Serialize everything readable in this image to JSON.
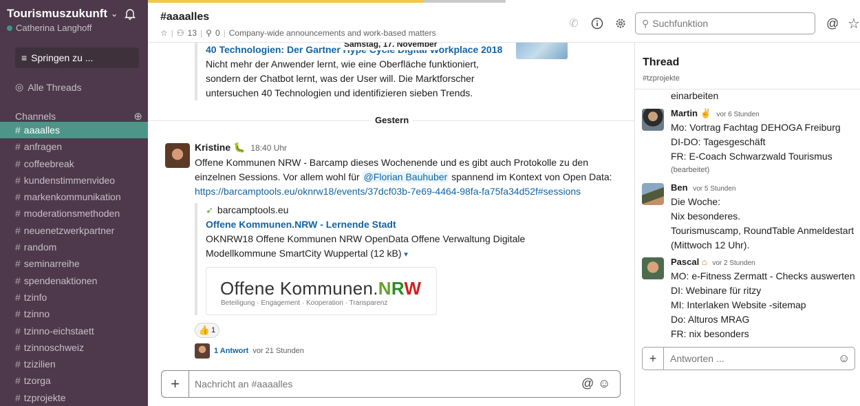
{
  "workspace": {
    "name": "Tourismuszukunft",
    "user": "Catherina Langhoff"
  },
  "sidebar": {
    "jump_label": "Springen zu ...",
    "threads_label": "Alle Threads",
    "channels_heading": "Channels",
    "channels": [
      "aaaalles",
      "anfragen",
      "coffeebreak",
      "kundenstimmenvideo",
      "markenkommunikation",
      "moderationsmethoden",
      "neuenetzwerkpartner",
      "random",
      "seminarreihe",
      "spendenaktionen",
      "tzinfo",
      "tzinno",
      "tzinno-eichstaett",
      "tzinnoschweiz",
      "tzizilien",
      "tzorga",
      "tzprojekte"
    ],
    "active_channel": "aaaalles"
  },
  "header": {
    "channel_title": "#aaaalles",
    "members": "13",
    "pins": "0",
    "description": "Company-wide announcements and work-based matters",
    "search_placeholder": "Suchfunktion"
  },
  "messages": {
    "date_pill": "Samstag, 17. November",
    "prev_attachment": {
      "title": "40 Technologien: Der Gartner Hype Cycle Digital Workplace 2018",
      "lines": [
        "Nicht mehr der Anwender lernt, wie eine Oberfläche funktioniert,",
        "sondern der Chatbot lernt, was der User will. Die Marktforscher",
        "untersuchen 40 Technologien und identifizieren sieben Trends."
      ]
    },
    "divider_label": "Gestern",
    "main": {
      "author": "Kristine",
      "time": "18:40 Uhr",
      "text_1": "Offene Kommunen NRW - Barcamp dieses Wochenende und es gibt auch Protokolle zu den",
      "text_2a": "einzelnen Sessions. Vor allem wohl für",
      "mention": "@Florian Bauhuber",
      "text_2b": "spannend im Kontext von Open Data:",
      "url": "https://barcamptools.eu/oknrw18/events/37dcf03b-7e69-4464-98fa-fa75fa34d52f#sessions",
      "attachment": {
        "source": "barcamptools.eu",
        "title": "Offene Kommunen.NRW - Lernende Stadt",
        "desc_1": "OKNRW18 Offene Kommunen NRW OpenData Offene Verwaltung Digitale",
        "desc_2": "Modellkommune SmartCity Wuppertal (12 kB)",
        "logo_prefix": "Offene Kommunen.",
        "logo_n": "N",
        "logo_r": "R",
        "logo_w": "W",
        "logo_tagline": "Beteiligung · Engagement · Kooperation · Transparenz"
      },
      "reaction_count": "1",
      "reply_count": "1 Antwort",
      "reply_time": "vor 21 Stunden"
    },
    "composer_placeholder": "Nachricht an #aaaalles"
  },
  "thread": {
    "title": "Thread",
    "channel": "#tzprojekte",
    "cut_text": "einarbeiten",
    "messages": [
      {
        "author": "Martin",
        "time": "vor 6 Stunden",
        "lines": [
          "Mo: Vortrag Fachtag DEHOGA Freiburg",
          "DI-DO: Tagesgeschäft",
          "FR: E-Coach Schwarzwald Tourismus"
        ],
        "edited": "(bearbeitet)"
      },
      {
        "author": "Ben",
        "time": "vor 5 Stunden",
        "lines": [
          "Die Woche:",
          "Nix besonderes.",
          "Tourismuscamp, RoundTable Anmeldestart",
          "(Mittwoch 12 Uhr)."
        ]
      },
      {
        "author": "Pascal",
        "time": "vor 2 Stunden",
        "lines": [
          "MO: e-Fitness Zermatt - Checks auswerten",
          "DI: Webinare für ritzy",
          "MI: Interlaken Website -sitemap",
          "Do: Alturos MRAG",
          "FR: nix besonders"
        ]
      }
    ],
    "reply_placeholder": "Antworten ..."
  }
}
